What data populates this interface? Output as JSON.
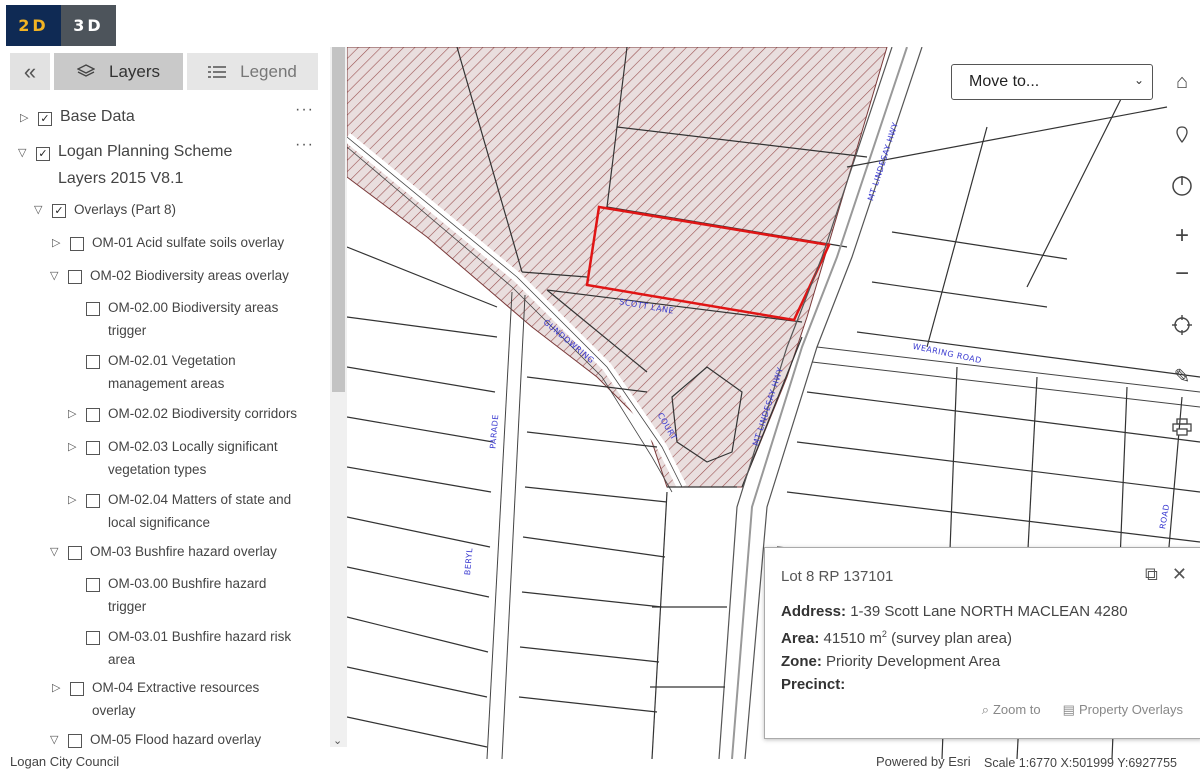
{
  "view_tabs": {
    "two_d": "2D",
    "three_d": "3D"
  },
  "panel": {
    "layers_tab": "Layers",
    "legend_tab": "Legend"
  },
  "tree": {
    "base_data": "Base Data",
    "planning_scheme_line1": "Logan Planning Scheme",
    "planning_scheme_line2": "Layers 2015 V8.1",
    "overlays": "Overlays (Part 8)",
    "om01": "OM-01 Acid sulfate soils overlay",
    "om02": "OM-02 Biodiversity areas overlay",
    "om0200_1": "OM-02.00 Biodiversity areas",
    "om0200_2": "trigger",
    "om0201_1": "OM-02.01 Vegetation",
    "om0201_2": "management areas",
    "om0202": "OM-02.02 Biodiversity corridors",
    "om0203_1": "OM-02.03 Locally significant",
    "om0203_2": "vegetation types",
    "om0204_1": "OM-02.04 Matters of state and",
    "om0204_2": "local significance",
    "om03": "OM-03 Bushfire hazard overlay",
    "om0300_1": "OM-03.00 Bushfire hazard",
    "om0300_2": "trigger",
    "om0301_1": "OM-03.01 Bushfire hazard risk",
    "om0301_2": "area",
    "om04_1": "OM-04 Extractive resources",
    "om04_2": "overlay",
    "om05": "OM-05 Flood hazard overlay",
    "more": "···"
  },
  "map": {
    "move_to": "Move to...",
    "roads": {
      "scott_lane": "SCOTT LANE",
      "wearing_road": "WEARING ROAD",
      "mt_lindesay_hwy": "MT LINDESAY HWY",
      "mt_lindesay_hwy_2": "MT LINDESAY HWY",
      "parade": "PARADE",
      "beryl": "BERYL",
      "road": "ROAD",
      "gundowring": "GUNDOWRING",
      "court": "COURT"
    }
  },
  "popup": {
    "title": "Lot 8 RP 137101",
    "address_label": "Address:",
    "address_value": "1-39 Scott Lane NORTH MACLEAN 4280",
    "area_label": "Area:",
    "area_value": "41510 m",
    "area_sup": "2",
    "area_note": "(survey plan area)",
    "zone_label": "Zone:",
    "zone_value": "Priority Development Area",
    "precinct_label": "Precinct:",
    "zoom_to": "Zoom to",
    "property_overlays": "Property Overlays"
  },
  "footer": {
    "attribution": "Logan City Council",
    "powered_by": "Powered by Esri",
    "scale": "Scale 1:6770 X:501999 Y:6927755"
  }
}
